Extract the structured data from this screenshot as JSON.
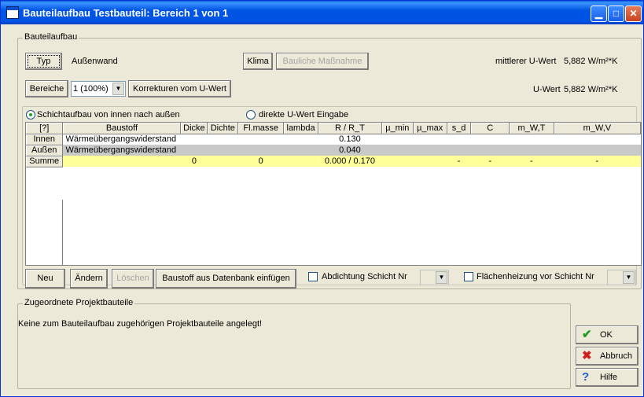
{
  "window": {
    "title": "Bauteilaufbau Testbauteil: Bereich 1 von 1"
  },
  "group_aufbau": {
    "title": "Bauteilaufbau",
    "typ_button": "Typ",
    "typ_value": "Außenwand",
    "klima_button": "Klima",
    "massnahme_button": "Bauliche Maßnahme",
    "mean_u_label": "mittlerer U-Wert",
    "mean_u_value": "5,882 W/m²*K",
    "bereiche_button": "Bereiche",
    "bereiche_select": "1 (100%)",
    "korrekturen_button": "Korrekturen vom U-Wert",
    "u_label": "U-Wert",
    "u_value": "5,882 W/m²*K"
  },
  "layers": {
    "radio_schicht": "Schichtaufbau von innen nach außen",
    "radio_direkt": "direkte U-Wert Eingabe",
    "columns": [
      "[?]",
      "Baustoff",
      "Dicke",
      "Dichte",
      "Fl.masse",
      "lambda",
      "R / R_T",
      "µ_min",
      "µ_max",
      "s_d",
      "C",
      "m_W,T",
      "m_W,V"
    ],
    "rows": [
      {
        "head": "Innen",
        "baustoff": "Wärmeübergangswiderstand",
        "dicke": "",
        "dichte": "",
        "flmasse": "",
        "lambda": "",
        "r": "0.130",
        "mu_min": "",
        "mu_max": "",
        "sd": "",
        "c": "",
        "mwt": "",
        "mwv": ""
      },
      {
        "head": "Außen",
        "baustoff": "Wärmeübergangswiderstand",
        "dicke": "",
        "dichte": "",
        "flmasse": "",
        "lambda": "",
        "r": "0.040",
        "mu_min": "",
        "mu_max": "",
        "sd": "",
        "c": "",
        "mwt": "",
        "mwv": ""
      },
      {
        "head": "Summe",
        "baustoff": "",
        "dicke": "0",
        "dichte": "",
        "flmasse": "0",
        "lambda": "",
        "r": "0.000 / 0.170",
        "mu_min": "",
        "mu_max": "",
        "sd": "-",
        "c": "-",
        "mwt": "-",
        "mwv": "-"
      }
    ],
    "neu_button": "Neu",
    "aendern_button": "Ändern",
    "loeschen_button": "Löschen",
    "einfuegen_button": "Baustoff aus Datenbank einfügen",
    "abdichtung_label": "Abdichtung Schicht Nr",
    "flaechenheizung_label": "Flächenheizung vor Schicht Nr"
  },
  "group_projekt": {
    "title": "Zugeordnete Projektbauteile",
    "message": "Keine zum Bauteilaufbau zugehörigen Projektbauteile angelegt!"
  },
  "dialog_buttons": {
    "ok": "OK",
    "abbruch": "Abbruch",
    "hilfe": "Hilfe"
  },
  "colors": {
    "titlebar": "#0054e3",
    "dialog_bg": "#ece9d8",
    "row_out": "#c9c9c9",
    "row_sum": "#ffff99",
    "ok_icon": "#1e9a1e",
    "abbruch_icon": "#cc1f1f",
    "hilfe_icon": "#1f5fcc"
  }
}
